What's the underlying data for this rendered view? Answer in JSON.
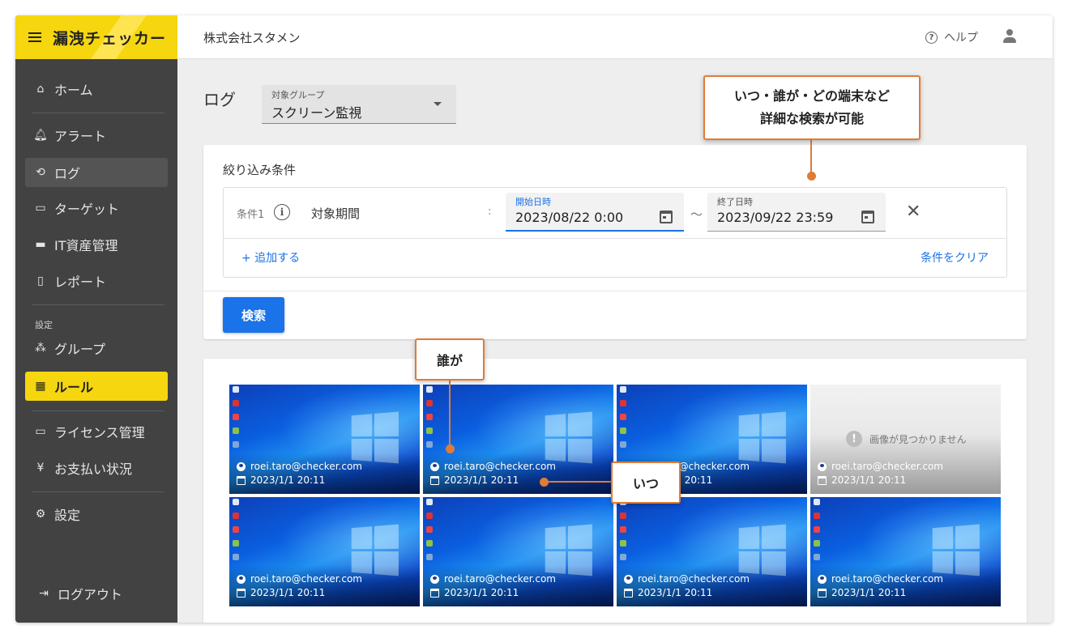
{
  "brand": {
    "title": "漏洩チェッカー"
  },
  "sidebar": {
    "items": [
      {
        "label": "ホーム",
        "icon": "home-icon"
      },
      {
        "label": "アラート",
        "icon": "bell-alert-icon"
      },
      {
        "label": "ログ",
        "icon": "history-icon"
      },
      {
        "label": "ターゲット",
        "icon": "computer-desk-icon"
      },
      {
        "label": "IT資産管理",
        "icon": "laptop-icon"
      },
      {
        "label": "レポート",
        "icon": "clipboard-icon"
      }
    ],
    "section_label": "設定",
    "settings_items": [
      {
        "label": "グループ",
        "icon": "group-icon"
      },
      {
        "label": "ルール",
        "icon": "grid-icon"
      },
      {
        "label": "ライセンス管理",
        "icon": "license-icon"
      },
      {
        "label": "お支払い状況",
        "icon": "yen-icon"
      },
      {
        "label": "設定",
        "icon": "gear-icon"
      }
    ],
    "logout": "ログアウト"
  },
  "header": {
    "company": "株式会社スタメン",
    "help": "ヘルプ"
  },
  "page": {
    "title": "ログ",
    "group_select": {
      "label": "対象グループ",
      "value": "スクリーン監視"
    }
  },
  "filter": {
    "title": "絞り込み条件",
    "condition": {
      "label": "条件1",
      "name": "対象期間",
      "separator": ":",
      "start": {
        "label": "開始日時",
        "value": "2023/08/22 0:00"
      },
      "tilde": "～",
      "end": {
        "label": "終了日時",
        "value": "2023/09/22 23:59"
      }
    },
    "add": "+ 追加する",
    "clear": "条件をクリア",
    "search": "検索"
  },
  "results": {
    "not_found": "画像が見つかりません",
    "items": [
      {
        "user": "roei.taro@checker.com",
        "time": "2023/1/1 20:11"
      },
      {
        "user": "roei.taro@checker.com",
        "time": "2023/1/1 20:11"
      },
      {
        "user": "roei.taro@checker.com",
        "time": "2023/1/1 20:11"
      },
      {
        "user": "roei.taro@checker.com",
        "time": "2023/1/1 20:11"
      },
      {
        "user": "roei.taro@checker.com",
        "time": "2023/1/1 20:11"
      },
      {
        "user": "roei.taro@checker.com",
        "time": "2023/1/1 20:11"
      },
      {
        "user": "roei.taro@checker.com",
        "time": "2023/1/1 20:11"
      },
      {
        "user": "roei.taro@checker.com",
        "time": "2023/1/1 20:11"
      }
    ]
  },
  "callouts": {
    "search_line1": "いつ・誰が・どの端末など",
    "search_line2": "詳細な検索が可能",
    "who": "誰が",
    "when": "いつ"
  },
  "colors": {
    "accent": "#f5d60f",
    "primary": "#1a73e8",
    "callout": "#e07b39",
    "sidebar": "#424242"
  }
}
